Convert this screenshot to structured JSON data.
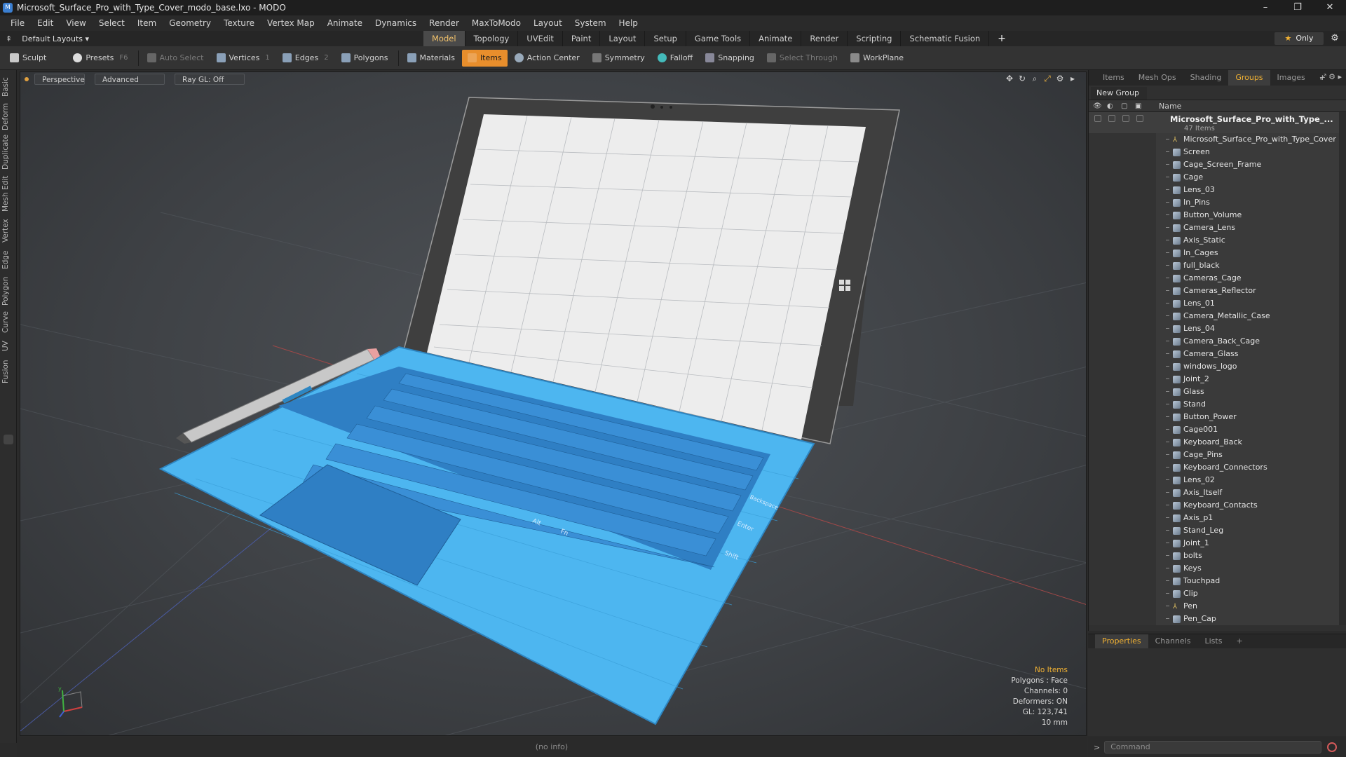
{
  "window": {
    "title": "Microsoft_Surface_Pro_with_Type_Cover_modo_base.lxo - MODO",
    "minimize": "–",
    "maximize": "❐",
    "close": "✕"
  },
  "menu": [
    "File",
    "Edit",
    "View",
    "Select",
    "Item",
    "Geometry",
    "Texture",
    "Vertex Map",
    "Animate",
    "Dynamics",
    "Render",
    "MaxToModo",
    "Layout",
    "System",
    "Help"
  ],
  "layout_bar": {
    "layout_select": "Default Layouts ▾",
    "tabs": [
      "Model",
      "Topology",
      "UVEdit",
      "Paint",
      "Layout",
      "Setup",
      "Game Tools",
      "Animate",
      "Render",
      "Scripting",
      "Schematic Fusion"
    ],
    "active_tab": "Model",
    "plus": "+",
    "only_label": "Only",
    "star": "★",
    "gear": "⚙"
  },
  "toolbar": {
    "sculpt": "Sculpt",
    "presets": "Presets",
    "presets_key": "F6",
    "auto_select": "Auto Select",
    "vertices": "Vertices",
    "vertices_count": "1",
    "edges": "Edges",
    "edges_count": "2",
    "polygons": "Polygons",
    "materials": "Materials",
    "items": "Items",
    "action_center": "Action Center",
    "symmetry": "Symmetry",
    "falloff": "Falloff",
    "snapping": "Snapping",
    "select_through": "Select Through",
    "workplane": "WorkPlane"
  },
  "left_tabs": [
    "Basic",
    "Deform",
    "Duplicate",
    "Mesh Edit",
    "Vertex",
    "Edge",
    "Polygon",
    "Curve",
    "UV",
    "Fusion"
  ],
  "viewport": {
    "perspective": "Perspective",
    "advanced": "Advanced",
    "raygl": "Ray GL: Off",
    "stats": {
      "no_items": "No Items",
      "polygons": "Polygons : Face",
      "channels": "Channels: 0",
      "deformers": "Deformers: ON",
      "gl": "GL: 123,741",
      "scale": "10 mm"
    },
    "keys": {
      "enter": "Enter",
      "shift": "Shift",
      "backspace": "Backspace",
      "fn": "Fn",
      "alt": "Alt"
    },
    "axis_y": "y",
    "axis_x": "x",
    "axis_z": "z"
  },
  "status": {
    "info": "(no info)"
  },
  "right_panel": {
    "tabs": [
      "Items",
      "Mesh Ops",
      "Shading",
      "Groups",
      "Images"
    ],
    "active_tab": "Groups",
    "plus": "+",
    "new_group": "New Group",
    "col_name": "Name",
    "group_name": "Microsoft_Surface_Pro_with_Type_...",
    "group_count": "47 Items",
    "items": [
      {
        "name": "Microsoft_Surface_Pro_with_Type_Cover",
        "type": "locator"
      },
      {
        "name": "Screen",
        "type": "mesh"
      },
      {
        "name": "Cage_Screen_Frame",
        "type": "mesh"
      },
      {
        "name": "Cage",
        "type": "mesh"
      },
      {
        "name": "Lens_03",
        "type": "mesh"
      },
      {
        "name": "In_Pins",
        "type": "mesh"
      },
      {
        "name": "Button_Volume",
        "type": "mesh"
      },
      {
        "name": "Camera_Lens",
        "type": "mesh"
      },
      {
        "name": "Axis_Static",
        "type": "mesh"
      },
      {
        "name": "In_Cages",
        "type": "mesh"
      },
      {
        "name": "full_black",
        "type": "mesh"
      },
      {
        "name": "Cameras_Cage",
        "type": "mesh"
      },
      {
        "name": "Cameras_Reflector",
        "type": "mesh"
      },
      {
        "name": "Lens_01",
        "type": "mesh"
      },
      {
        "name": "Camera_Metallic_Case",
        "type": "mesh"
      },
      {
        "name": "Lens_04",
        "type": "mesh"
      },
      {
        "name": "Camera_Back_Cage",
        "type": "mesh"
      },
      {
        "name": "Camera_Glass",
        "type": "mesh"
      },
      {
        "name": "windows_logo",
        "type": "mesh"
      },
      {
        "name": "Joint_2",
        "type": "mesh"
      },
      {
        "name": "Glass",
        "type": "mesh"
      },
      {
        "name": "Stand",
        "type": "mesh"
      },
      {
        "name": "Button_Power",
        "type": "mesh"
      },
      {
        "name": "Cage001",
        "type": "mesh"
      },
      {
        "name": "Keyboard_Back",
        "type": "mesh"
      },
      {
        "name": "Cage_Pins",
        "type": "mesh"
      },
      {
        "name": "Keyboard_Connectors",
        "type": "mesh"
      },
      {
        "name": "Lens_02",
        "type": "mesh"
      },
      {
        "name": "Axis_Itself",
        "type": "mesh"
      },
      {
        "name": "Keyboard_Contacts",
        "type": "mesh"
      },
      {
        "name": "Axis_p1",
        "type": "mesh"
      },
      {
        "name": "Stand_Leg",
        "type": "mesh"
      },
      {
        "name": "Joint_1",
        "type": "mesh"
      },
      {
        "name": "bolts",
        "type": "mesh"
      },
      {
        "name": "Keys",
        "type": "mesh"
      },
      {
        "name": "Touchpad",
        "type": "mesh"
      },
      {
        "name": "Clip",
        "type": "mesh"
      },
      {
        "name": "Pen",
        "type": "locator"
      },
      {
        "name": "Pen_Cap",
        "type": "mesh"
      }
    ]
  },
  "properties_panel": {
    "tabs": [
      "Properties",
      "Channels",
      "Lists"
    ],
    "active_tab": "Properties",
    "plus": "+"
  },
  "command": {
    "prompt": ">",
    "placeholder": "Command"
  },
  "colors": {
    "accent": "#e88e2c",
    "keyboard_blue": "#3fa9e8",
    "keys_blue": "#2f7fc4",
    "bezel": "#3c3c3c"
  }
}
